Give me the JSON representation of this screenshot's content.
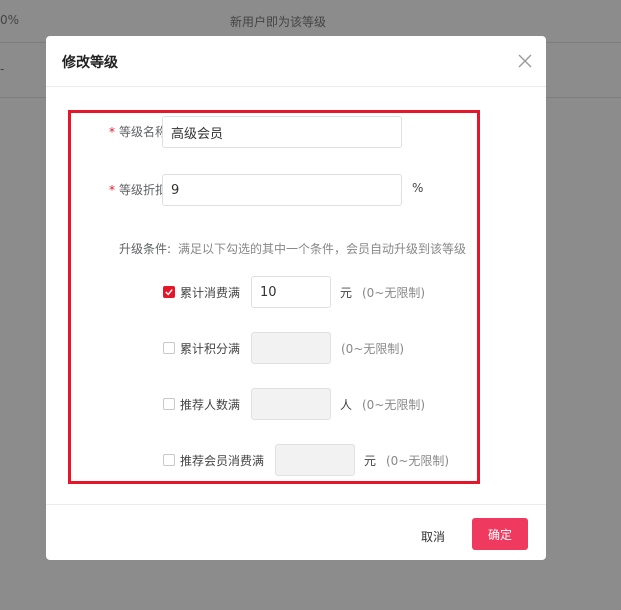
{
  "background": {
    "row1_left": "0%",
    "row1_center": "新用户即为该等级",
    "row2_left": "-"
  },
  "modal": {
    "title": "修改等级",
    "fields": {
      "name_label": "等级名称:",
      "name_value": "高级会员",
      "discount_label": "等级折扣:",
      "discount_value": "9",
      "discount_unit": "%",
      "upgrade_label": "升级条件:",
      "upgrade_hint": "满足以下勾选的其中一个条件，会员自动升级到该等级"
    },
    "conditions": [
      {
        "label": "累计消费满",
        "checked": true,
        "value": "10",
        "unit": "元",
        "hint": "(0~无限制)"
      },
      {
        "label": "累计积分满",
        "checked": false,
        "value": "",
        "unit": "",
        "hint": "(0~无限制)"
      },
      {
        "label": "推荐人数满",
        "checked": false,
        "value": "",
        "unit": "人",
        "hint": "(0~无限制)"
      },
      {
        "label": "推荐会员消费满",
        "checked": false,
        "value": "",
        "unit": "元",
        "hint": "(0~无限制)"
      }
    ],
    "buttons": {
      "cancel": "取消",
      "ok": "确定"
    }
  },
  "colors": {
    "accent": "#e5162a",
    "primary_button": "#f0395f"
  }
}
